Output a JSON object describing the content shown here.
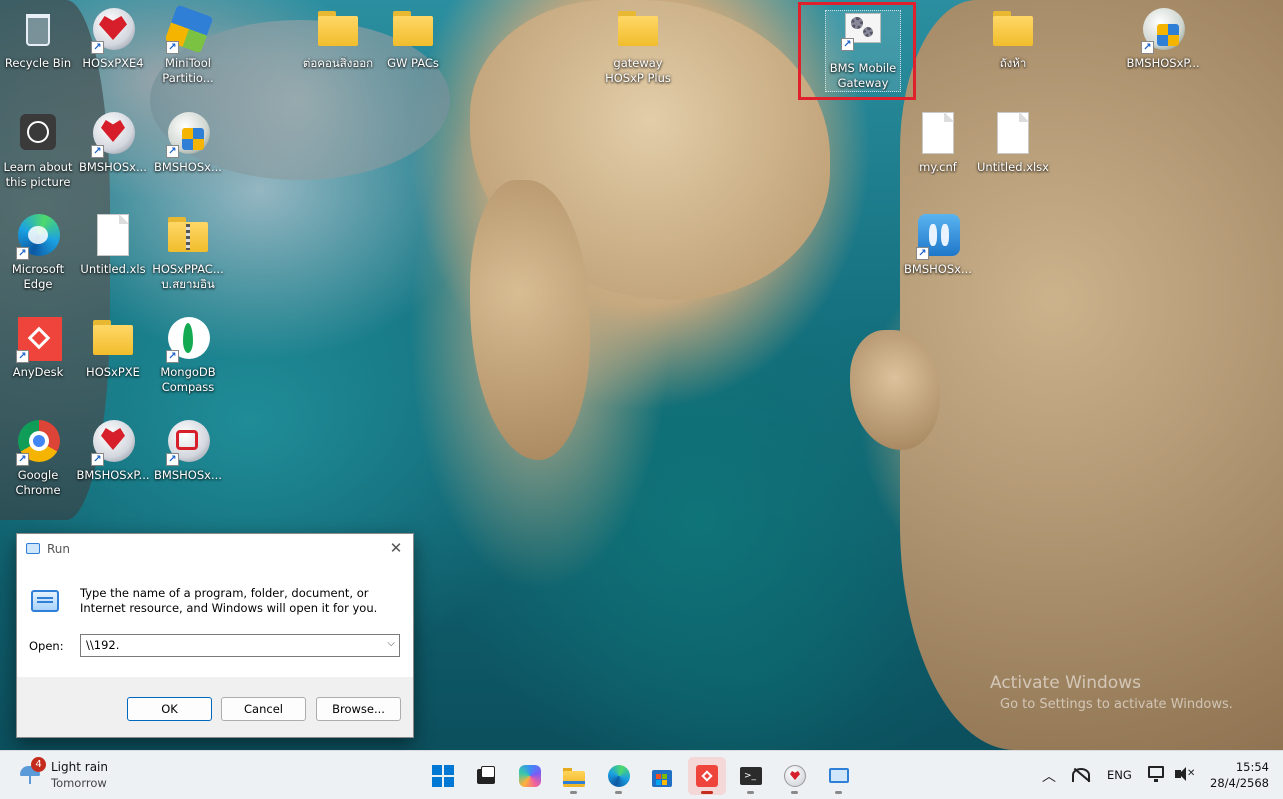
{
  "desktop": {
    "icons": {
      "recycle_bin": "Recycle Bin",
      "hosxpxe4": "HOSxPXE4",
      "minitool": "MiniTool Partitio...",
      "thai_folder_1": "ต่อคอนสิ่งออก",
      "gw_pacs": "GW PACs",
      "gateway_hosxp_plus": "gateway HOSxP Plus",
      "bms_mobile_gateway": "BMS Mobile Gateway",
      "thai_folder_2": "ถังห้า",
      "bmshosxp_top_right": "BMSHOSxP...",
      "learn_picture": "Learn about this picture",
      "bmshosx_1": "BMSHOSx...",
      "bmshosx_2": "BMSHOSx...",
      "my_cnf": "my.cnf",
      "untitled_xlsx": "Untitled.xlsx",
      "edge": "Microsoft Edge",
      "untitled_xls": "Untitled.xls",
      "hosxppac": "HOSxPPAC... บ.สยามอินเต...",
      "bmshosx_right": "BMSHOSx...",
      "anydesk": "AnyDesk",
      "hosxpxe": "HOSxPXE",
      "mongodb": "MongoDB Compass",
      "chrome": "Google Chrome",
      "bmshosxp_3": "BMSHOSxP...",
      "bmshosx_4": "BMSHOSx..."
    },
    "watermark": {
      "line1": "Activate Windows",
      "line2": "Go to Settings to activate Windows."
    }
  },
  "run_dialog": {
    "title": "Run",
    "description": "Type the name of a program, folder, document, or Internet resource, and Windows will open it for you.",
    "open_label": "Open:",
    "input_value": "\\\\192.",
    "ok_label": "OK",
    "cancel_label": "Cancel",
    "browse_label": "Browse..."
  },
  "taskbar": {
    "weather": {
      "badge": "4",
      "main": "Light rain",
      "sub": "Tomorrow"
    },
    "language": "ENG",
    "time": "15:54",
    "date": "28/4/2568",
    "colors": {
      "accent": "#0078d4",
      "anydesk": "#ef443b"
    }
  }
}
